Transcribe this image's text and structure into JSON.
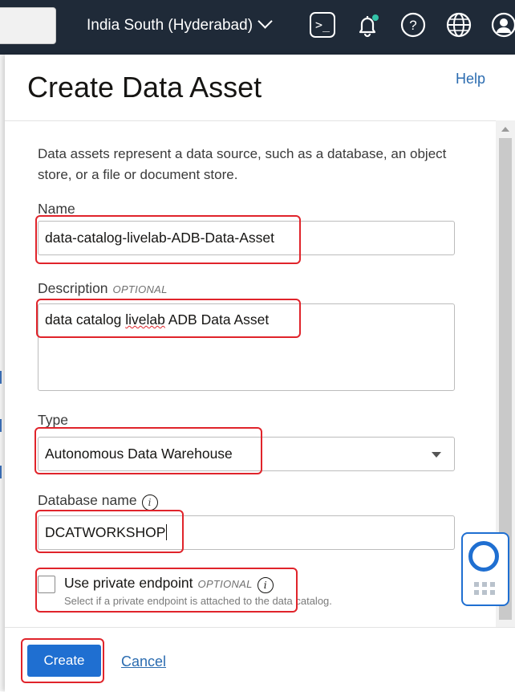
{
  "topbar": {
    "region": "India South (Hyderabad)",
    "icons": [
      "cloud-shell-icon",
      "bell-icon",
      "help-icon",
      "globe-icon",
      "profile-icon"
    ],
    "colors": {
      "background": "#1f2a38",
      "notification_dot": "#33c3a8"
    }
  },
  "panel": {
    "title": "Create Data Asset",
    "help_link": "Help",
    "description": "Data assets represent a data source, such as a database, an object store, or a file or document store."
  },
  "form": {
    "name": {
      "label": "Name",
      "value": "data-catalog-livelab-ADB-Data-Asset"
    },
    "description": {
      "label": "Description",
      "optional": "OPTIONAL",
      "value_pre": "data catalog ",
      "value_misspelled": "livelab",
      "value_post": " ADB Data Asset"
    },
    "type": {
      "label": "Type",
      "value": "Autonomous Data Warehouse"
    },
    "database_name": {
      "label": "Database name",
      "value": "DCATWORKSHOP"
    },
    "private_endpoint": {
      "label": "Use private endpoint",
      "optional": "OPTIONAL",
      "help": "Select if a private endpoint is attached to the data catalog.",
      "checked": false
    }
  },
  "footer": {
    "create_label": "Create",
    "cancel_label": "Cancel"
  },
  "colors": {
    "primary": "#1f6fd1",
    "link": "#2b6cb0",
    "highlight": "#e0242b"
  }
}
